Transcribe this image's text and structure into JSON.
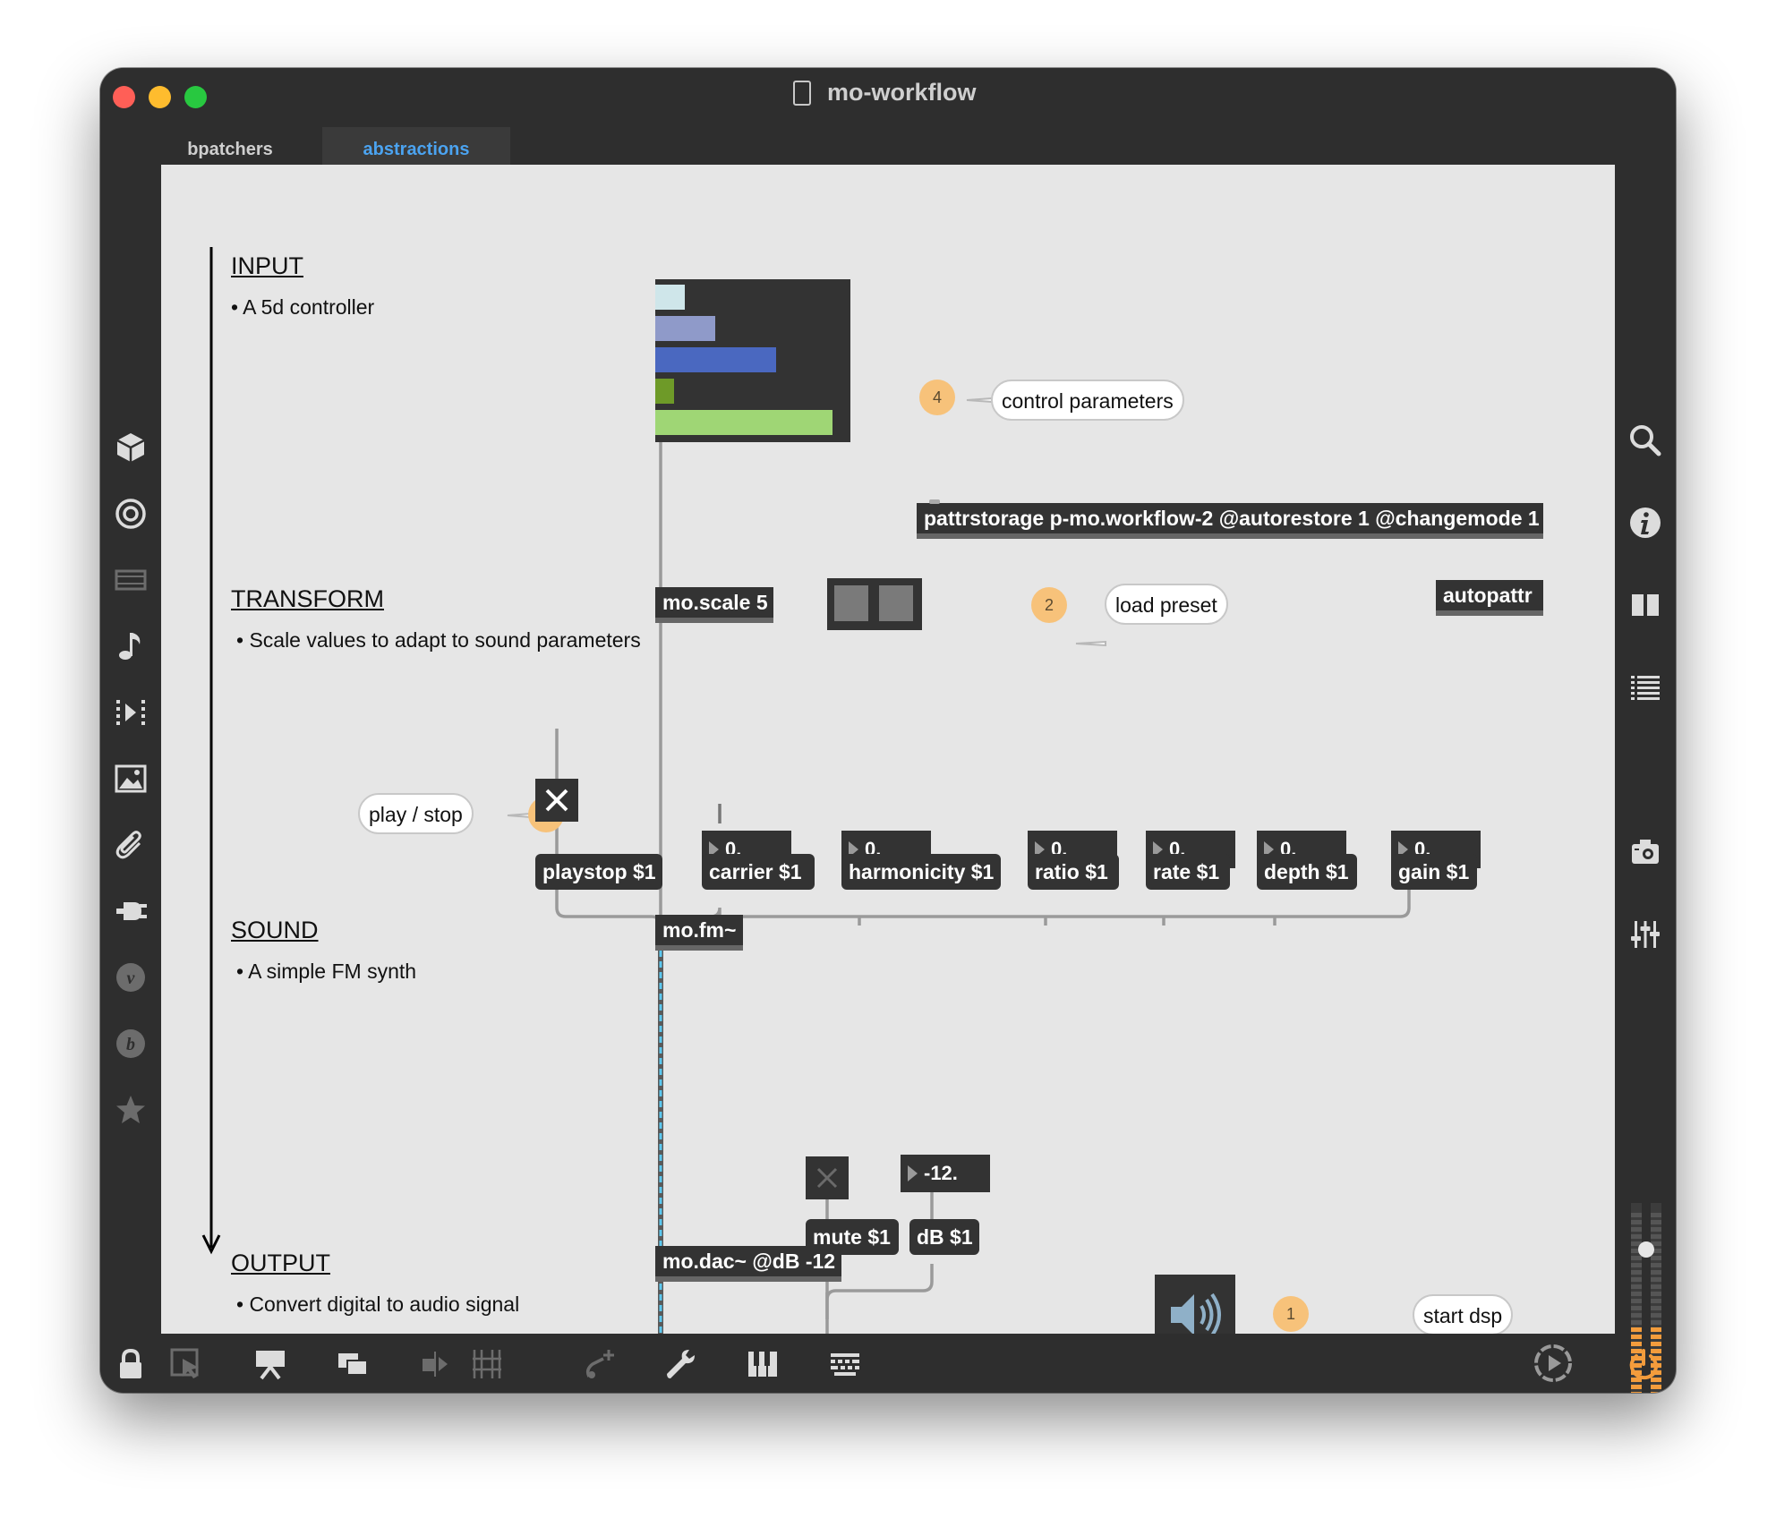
{
  "window": {
    "title": "mo-workflow",
    "traffic_lights": [
      "#ff5f57",
      "#febc2e",
      "#28c840"
    ]
  },
  "tabs": [
    {
      "label": "bpatchers",
      "active": false
    },
    {
      "label": "abstractions",
      "active": true
    }
  ],
  "colors": {
    "accent": "#4ba3f0",
    "badge": "#f7c27a",
    "cable_audio": "#5bc8f0"
  },
  "sections": {
    "input": {
      "heading": "INPUT",
      "text": "• A 5d controller"
    },
    "transform": {
      "heading": "TRANSFORM",
      "text": "• Scale values to adapt to sound parameters"
    },
    "sound": {
      "heading": "SOUND",
      "text": "• A simple FM synth"
    },
    "output": {
      "heading": "OUTPUT",
      "text": "• Convert digital to audio signal"
    }
  },
  "multislider": {
    "values": [
      0.16,
      0.32,
      0.65,
      0.1,
      0.95
    ],
    "colors": [
      "#cfe6ea",
      "#8f9ac9",
      "#4a68c0",
      "#6e9a28",
      "#9fd675"
    ]
  },
  "annotations": {
    "control_parameters": {
      "number": "4",
      "label": "control parameters"
    },
    "load_preset": {
      "number": "2",
      "label": "load preset"
    },
    "play_stop": {
      "number": "3",
      "label": "play / stop"
    },
    "start_dsp": {
      "number": "1",
      "label": "start dsp"
    }
  },
  "objects": {
    "pattrstorage": "pattrstorage p-mo.workflow-2 @autorestore 1 @changemode 1",
    "autopattr": "autopattr",
    "scale": "mo.scale 5",
    "fm": "mo.fm~",
    "dac": "mo.dac~ @dB -12"
  },
  "messages": {
    "playstop": "playstop $1",
    "carrier": "carrier $1",
    "harmonicity": "harmonicity $1",
    "ratio": "ratio $1",
    "rate": "rate $1",
    "depth": "depth $1",
    "gain": "gain $1",
    "mute": "mute $1",
    "db": "dB $1"
  },
  "numboxes": {
    "carrier": "0.",
    "harmonicity": "0.",
    "ratio": "0.",
    "rate": "0.",
    "depth": "0.",
    "gain": "0.",
    "db": "-12."
  },
  "toggles": {
    "play": true,
    "mute": false
  },
  "level_meter": {
    "level": 0.0
  }
}
